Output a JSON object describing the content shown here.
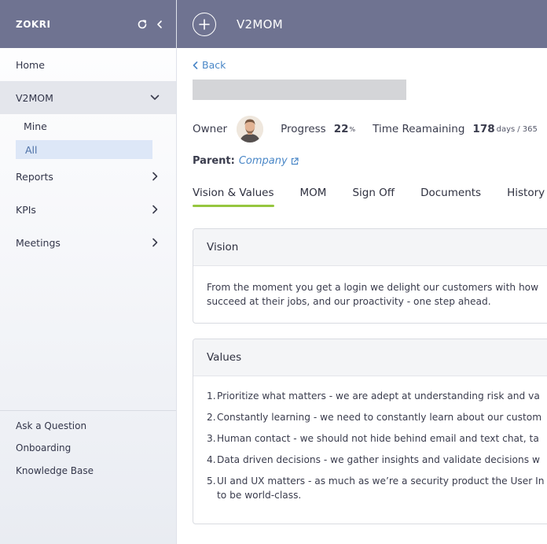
{
  "sidebar": {
    "brand": "ZOKRI",
    "nav": [
      {
        "label": "Home"
      },
      {
        "label": "V2MOM"
      },
      {
        "label": "Reports"
      },
      {
        "label": "KPIs"
      },
      {
        "label": "Meetings"
      }
    ],
    "sub": [
      {
        "label": "Mine"
      },
      {
        "label": "All"
      }
    ],
    "footer": [
      {
        "label": "Ask a Question"
      },
      {
        "label": "Onboarding"
      },
      {
        "label": "Knowledge Base"
      }
    ]
  },
  "topbar": {
    "title": "V2MOM"
  },
  "main": {
    "back_label": "Back",
    "owner_label": "Owner",
    "progress_label": "Progress",
    "progress_value": "22",
    "progress_unit": "%",
    "time_label": "Time Reamaining",
    "days_remaining": "178",
    "days_unit": "days",
    "days_total": "/ 365",
    "parent_label": "Parent:",
    "parent_value": "Company",
    "tabs": [
      {
        "label": "Vision & Values"
      },
      {
        "label": "MOM"
      },
      {
        "label": "Sign Off"
      },
      {
        "label": "Documents"
      },
      {
        "label": "History"
      }
    ],
    "vision": {
      "title": "Vision",
      "lines": [
        "From the moment you get a login we delight our customers with how",
        "succeed at their jobs, and our proactivity - one step ahead."
      ]
    },
    "values": {
      "title": "Values",
      "items": [
        {
          "num": "1.",
          "lines": [
            "Prioritize what matters - we are adept at understanding risk and va"
          ]
        },
        {
          "num": "2.",
          "lines": [
            "Constantly learning - we need to constantly learn about our custom"
          ]
        },
        {
          "num": "3.",
          "lines": [
            "Human contact - we should not hide behind email and text chat, ta"
          ]
        },
        {
          "num": "4.",
          "lines": [
            "Data driven decisions - we gather insights and validate decisions w"
          ]
        },
        {
          "num": "5.",
          "lines": [
            "UI and UX matters - as much as we’re a security product the User In",
            "to be world-class."
          ]
        }
      ]
    }
  },
  "colors": {
    "header": "#6f7391",
    "accent_link": "#4a87c7",
    "tab_underline": "#96c63f",
    "selected_bg": "#dde7f7"
  }
}
